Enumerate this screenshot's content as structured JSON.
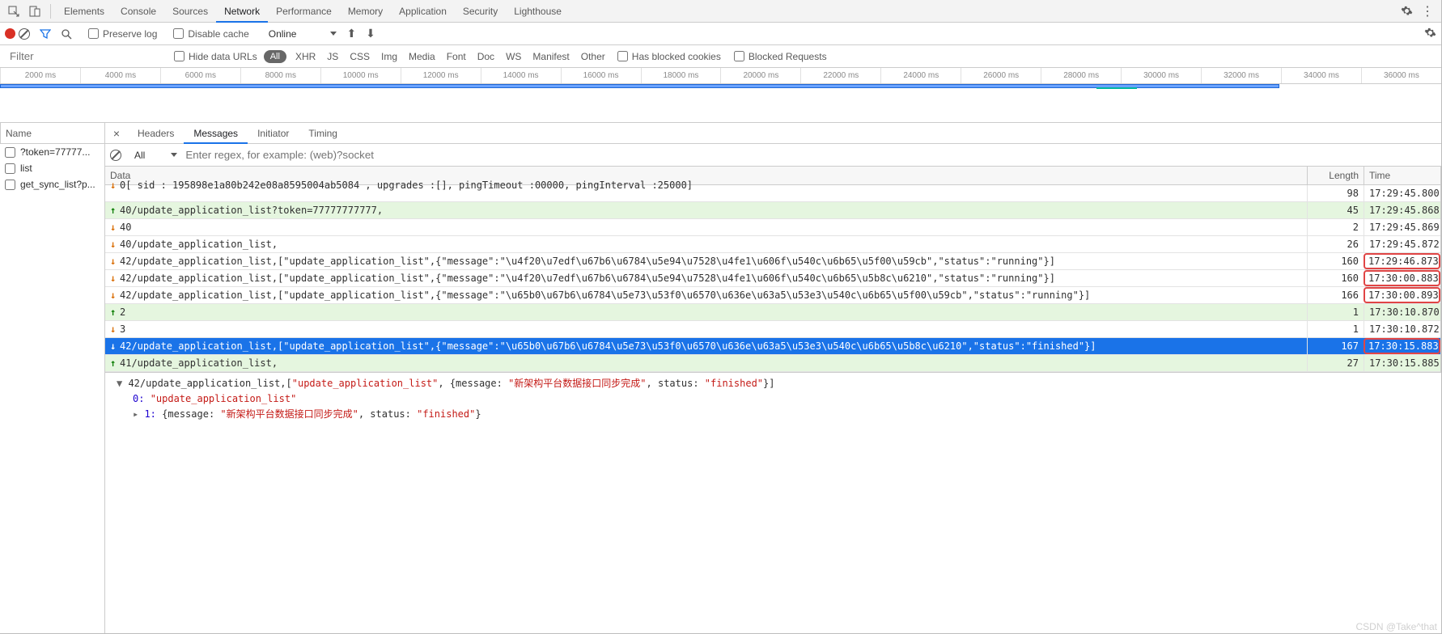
{
  "mainTabs": {
    "elements": "Elements",
    "console": "Console",
    "sources": "Sources",
    "network": "Network",
    "performance": "Performance",
    "memory": "Memory",
    "application": "Application",
    "security": "Security",
    "lighthouse": "Lighthouse"
  },
  "toolbar": {
    "preserve_log": "Preserve log",
    "disable_cache": "Disable cache",
    "online": "Online"
  },
  "filterbar": {
    "filter_placeholder": "Filter",
    "hide_urls": "Hide data URLs",
    "all": "All",
    "xhr": "XHR",
    "js": "JS",
    "css": "CSS",
    "img": "Img",
    "media": "Media",
    "font": "Font",
    "doc": "Doc",
    "ws": "WS",
    "manifest": "Manifest",
    "other": "Other",
    "has_blocked": "Has blocked cookies",
    "blocked_req": "Blocked Requests"
  },
  "ruler_ticks": [
    "2000 ms",
    "4000 ms",
    "6000 ms",
    "8000 ms",
    "10000 ms",
    "12000 ms",
    "14000 ms",
    "16000 ms",
    "18000 ms",
    "20000 ms",
    "22000 ms",
    "24000 ms",
    "26000 ms",
    "28000 ms",
    "30000 ms",
    "32000 ms",
    "34000 ms",
    "36000 ms"
  ],
  "left": {
    "name": "Name",
    "items": [
      "?token=77777...",
      "list",
      "get_sync_list?p..."
    ]
  },
  "detailTabs": {
    "headers": "Headers",
    "messages": "Messages",
    "initiator": "Initiator",
    "timing": "Timing"
  },
  "msgToolbar": {
    "all": "All",
    "regex_placeholder": "Enter regex, for example: (web)?socket"
  },
  "msgHeader": {
    "data": "Data",
    "length": "Length",
    "time": "Time"
  },
  "messages": [
    {
      "dir": "down",
      "green": false,
      "data": "0[ sid : 195898e1a80b242e08a8595004ab5084 , upgrades :[], pingTimeout :00000, pingInterval :25000]",
      "len": "98",
      "time": "17:29:45.800",
      "boxed": false,
      "sel": false,
      "clipped": true
    },
    {
      "dir": "up",
      "green": true,
      "data": "40/update_application_list?token=77777777777,",
      "len": "45",
      "time": "17:29:45.868",
      "boxed": false,
      "sel": false
    },
    {
      "dir": "down",
      "green": false,
      "data": "40",
      "len": "2",
      "time": "17:29:45.869",
      "boxed": false,
      "sel": false
    },
    {
      "dir": "down",
      "green": false,
      "data": "40/update_application_list,",
      "len": "26",
      "time": "17:29:45.872",
      "boxed": false,
      "sel": false
    },
    {
      "dir": "down",
      "green": false,
      "data": "42/update_application_list,[\"update_application_list\",{\"message\":\"\\u4f20\\u7edf\\u67b6\\u6784\\u5e94\\u7528\\u4fe1\\u606f\\u540c\\u6b65\\u5f00\\u59cb\",\"status\":\"running\"}]",
      "len": "160",
      "time": "17:29:46.873",
      "boxed": true,
      "sel": false
    },
    {
      "dir": "down",
      "green": false,
      "data": "42/update_application_list,[\"update_application_list\",{\"message\":\"\\u4f20\\u7edf\\u67b6\\u6784\\u5e94\\u7528\\u4fe1\\u606f\\u540c\\u6b65\\u5b8c\\u6210\",\"status\":\"running\"}]",
      "len": "160",
      "time": "17:30:00.883",
      "boxed": true,
      "sel": false
    },
    {
      "dir": "down",
      "green": false,
      "data": "42/update_application_list,[\"update_application_list\",{\"message\":\"\\u65b0\\u67b6\\u6784\\u5e73\\u53f0\\u6570\\u636e\\u63a5\\u53e3\\u540c\\u6b65\\u5f00\\u59cb\",\"status\":\"running\"}]",
      "len": "166",
      "time": "17:30:00.893",
      "boxed": true,
      "sel": false
    },
    {
      "dir": "up",
      "green": true,
      "data": "2",
      "len": "1",
      "time": "17:30:10.870",
      "boxed": false,
      "sel": false
    },
    {
      "dir": "down",
      "green": false,
      "data": "3",
      "len": "1",
      "time": "17:30:10.872",
      "boxed": false,
      "sel": false
    },
    {
      "dir": "down",
      "green": false,
      "data": "42/update_application_list,[\"update_application_list\",{\"message\":\"\\u65b0\\u67b6\\u6784\\u5e73\\u53f0\\u6570\\u636e\\u63a5\\u53e3\\u540c\\u6b65\\u5b8c\\u6210\",\"status\":\"finished\"}]",
      "len": "167",
      "time": "17:30:15.883",
      "boxed": true,
      "sel": true
    },
    {
      "dir": "up",
      "green": true,
      "data": "41/update_application_list,",
      "len": "27",
      "time": "17:30:15.885",
      "boxed": false,
      "sel": false
    }
  ],
  "preview": {
    "line1a": "42/update_application_list,[",
    "line1b": "\"update_application_list\"",
    "line1c": ", {message: ",
    "line1d": "\"新架构平台数据接口同步完成\"",
    "line1e": ", status: ",
    "line1f": "\"finished\"",
    "line1g": "}]",
    "line2a": "0: ",
    "line2b": "\"update_application_list\"",
    "line3a": "1: ",
    "line3b": "{message: ",
    "line3c": "\"新架构平台数据接口同步完成\"",
    "line3d": ", status: ",
    "line3e": "\"finished\"",
    "line3f": "}"
  },
  "watermark": "CSDN @Take^that"
}
